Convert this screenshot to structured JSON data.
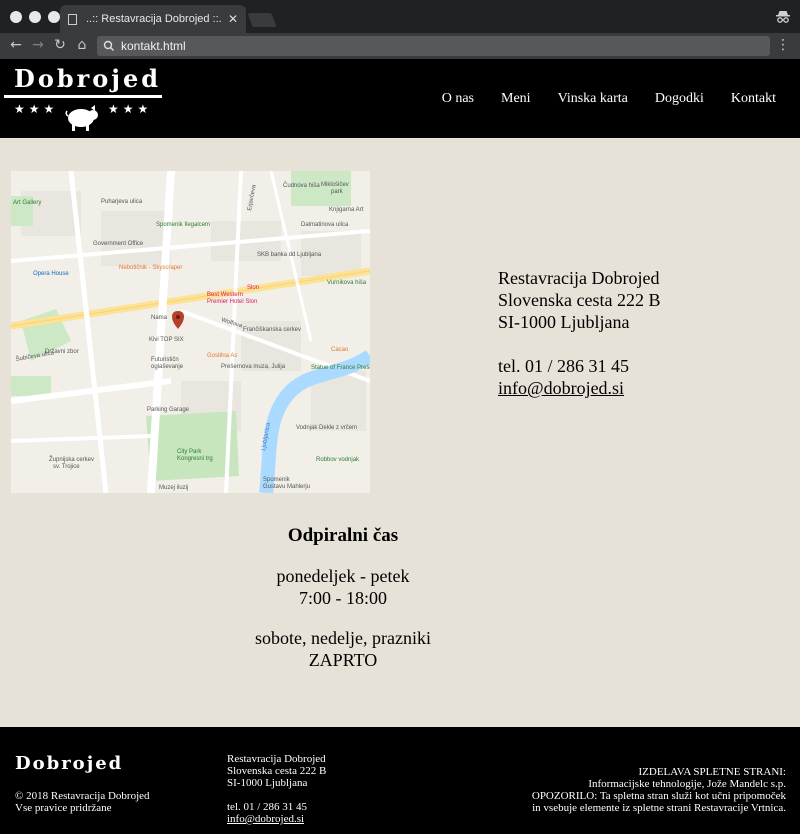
{
  "browser": {
    "tab_title": "..:: Restavracija Dobrojed ::..",
    "url": "kontakt.html"
  },
  "header": {
    "logo_text": "Dobrojed",
    "nav": [
      "O nas",
      "Meni",
      "Vinska karta",
      "Dogodki",
      "Kontakt"
    ]
  },
  "map": {
    "labels": [
      "Čudnova hiša",
      "Miklošičev park",
      "Knjigarna Art",
      "Puharjeva ulica",
      "Dalmatinova ulica",
      "Art Gallery",
      "Spomenik Ilegalcem",
      "Government Office",
      "SKB banka dd Ljubljana",
      "Nebotičnik - Skyscraper",
      "Vurnikova hiša",
      "Opera House",
      "Best Western Premier Hotel Slon",
      "Slon",
      "Frančiškanska cerkev",
      "Nama",
      "Kivi TOP SIX",
      "Državni zbor",
      "Futurističn oglaševanje",
      "Gostilna As",
      "Prešernova muza, Julija",
      "Cacao",
      "Statue of France Prešeren",
      "Parking Garage",
      "Vodnjak Dekle z vrčem",
      "Robbov vodnjak",
      "City Park",
      "Kongresni trg",
      "Župnijska cerkev sv. Trojice",
      "Muzej iluzij",
      "Spomenik Gustavu Mahlerju",
      "Ljubljanica",
      "Erjavčeva",
      "Šubičeva ulica",
      "Wolfova"
    ]
  },
  "contact": {
    "name": "Restavracija Dobrojed",
    "street": "Slovenska cesta 222 B",
    "city": "SI-1000 Ljubljana",
    "phone": "tel. 01 / 286 31 45",
    "email": "info@dobrojed.si"
  },
  "hours": {
    "title": "Odpiralni čas",
    "weekday_label": "ponedeljek - petek",
    "weekday_time": "7:00 - 18:00",
    "weekend_label": "sobote, nedelje, prazniki",
    "weekend_time": "ZAPRTO"
  },
  "footer": {
    "logo_text": "Dobrojed",
    "copyright": "© 2018 Restavracija Dobrojed",
    "rights": "Vse pravice pridržane",
    "contact_name": "Restavracija Dobrojed",
    "contact_street": "Slovenska cesta 222 B",
    "contact_city": "SI-1000 Ljubljana",
    "contact_phone": "tel. 01 / 286 31 45",
    "contact_email": "info@dobrojed.si",
    "credits_title": "IZDELAVA SPLETNE STRANI:",
    "credits_line1": "Informacijske tehnologije, Jože Mandelc s.p.",
    "credits_line2": "OPOZORILO: Ta spletna stran služi kot učni pripomoček",
    "credits_line3": "in vsebuje elemente iz spletne strani Restavracije Vrtnica."
  }
}
